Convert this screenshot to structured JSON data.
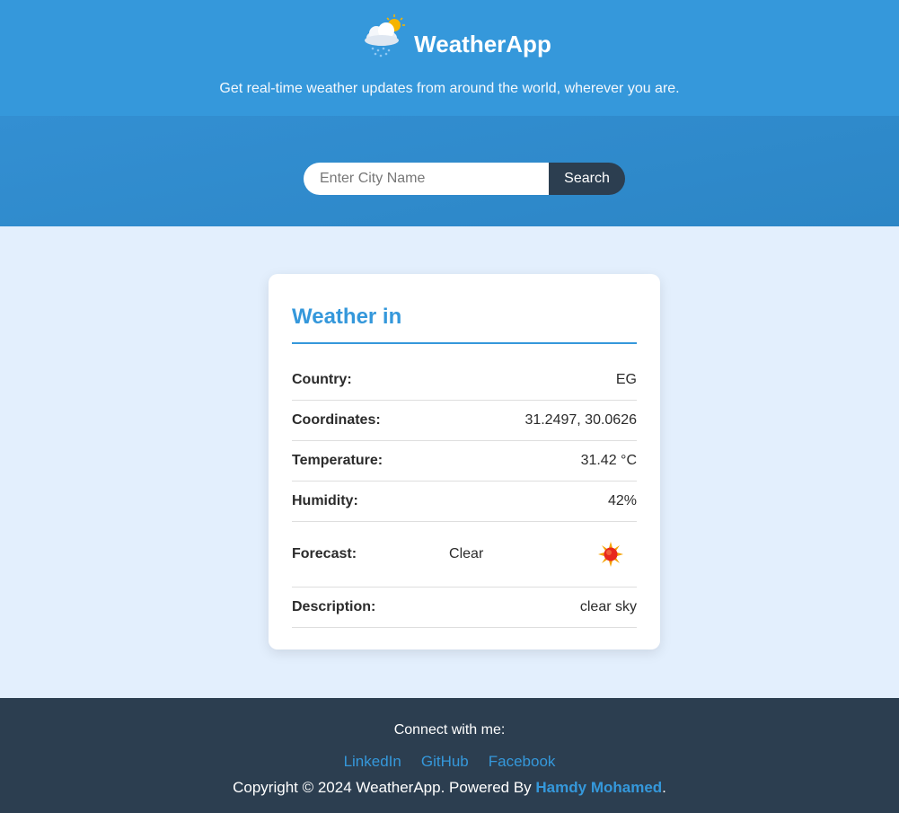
{
  "header": {
    "title": "WeatherApp",
    "tagline": "Get real-time weather updates from around the world, wherever you are.",
    "logo_icon": "cloud-rain-sun-icon"
  },
  "search": {
    "placeholder": "Enter City Name",
    "value": "",
    "button_label": "Search"
  },
  "weather": {
    "title": "Weather in",
    "rows": [
      {
        "label": "Country:",
        "value": "EG"
      },
      {
        "label": "Coordinates:",
        "value": "31.2497, 30.0626"
      },
      {
        "label": "Temperature:",
        "value": "31.42 °C"
      },
      {
        "label": "Humidity:",
        "value": "42%"
      },
      {
        "label": "Forecast:",
        "value": "Clear",
        "icon": "sun-icon"
      },
      {
        "label": "Description:",
        "value": "clear sky"
      }
    ]
  },
  "footer": {
    "connect": "Connect with me:",
    "links": [
      "LinkedIn",
      "GitHub",
      "Facebook"
    ],
    "copyright_prefix": "Copyright © 2024 WeatherApp. Powered By ",
    "author": "Hamdy Mohamed",
    "copyright_suffix": "."
  },
  "colors": {
    "primary": "#3598db",
    "dark": "#2c3e50",
    "background": "#e3effd"
  }
}
